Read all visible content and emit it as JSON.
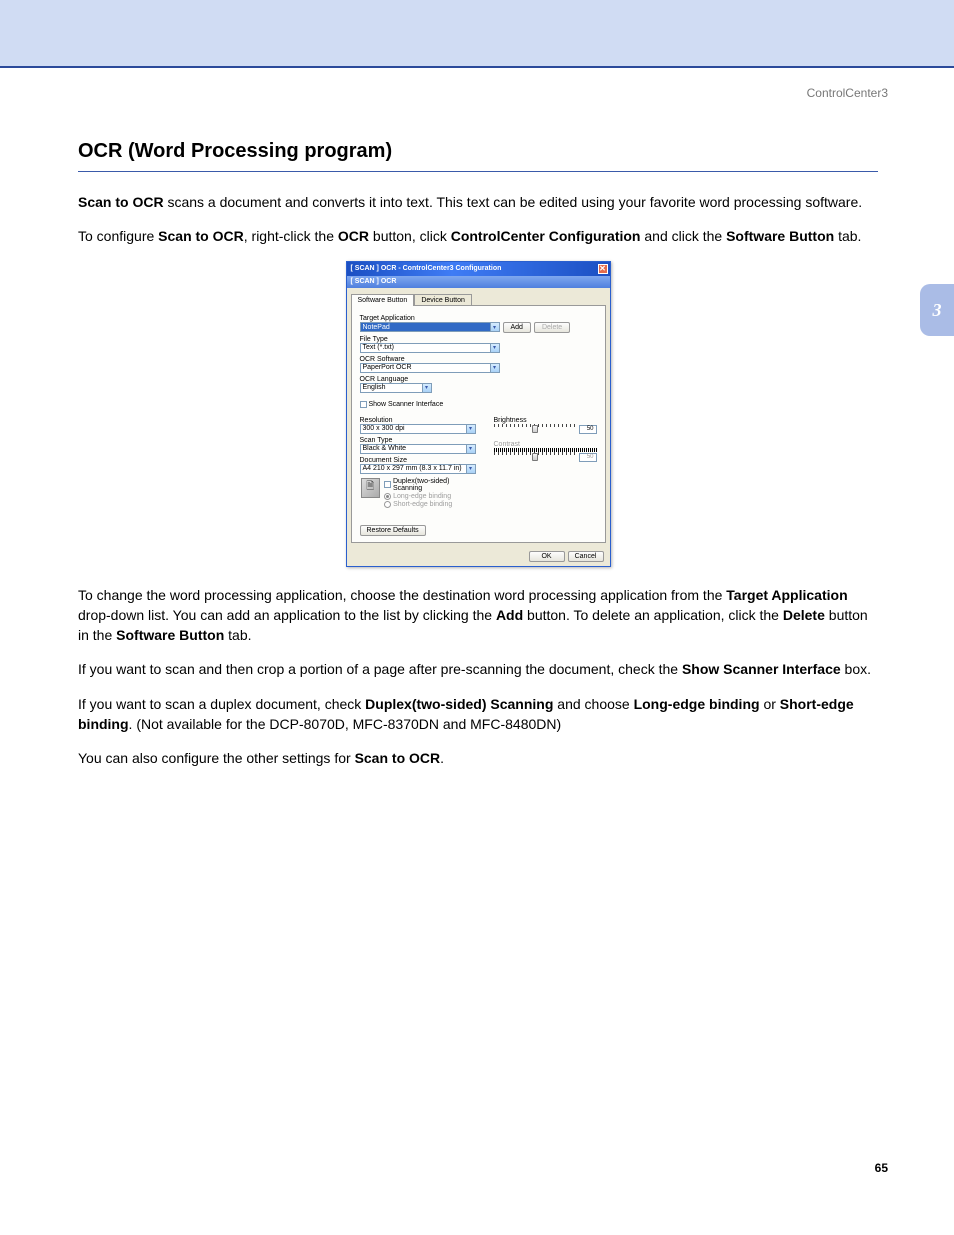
{
  "header_right": "ControlCenter3",
  "side_tab": "3",
  "page_number": "65",
  "title": "OCR (Word Processing program)",
  "para1_a": "Scan to OCR",
  "para1_b": " scans a document and converts it into text. This text can be edited using your favorite word processing software.",
  "para2_a": "To configure ",
  "para2_b": "Scan to OCR",
  "para2_c": ", right-click the ",
  "para2_d": "OCR",
  "para2_e": " button, click ",
  "para2_f": "ControlCenter Configuration",
  "para2_g": " and click the ",
  "para2_h": "Software Button",
  "para2_i": " tab.",
  "para3_a": "To change the word processing application, choose the destination word processing application from the ",
  "para3_b": "Target Application",
  "para3_c": " drop-down list. You can add an application to the list by clicking the ",
  "para3_d": "Add",
  "para3_e": " button. To delete an application, click the ",
  "para3_f": "Delete",
  "para3_g": " button in the ",
  "para3_h": "Software Button",
  "para3_i": " tab.",
  "para4_a": "If you want to scan and then crop a portion of a page after pre-scanning the document, check the ",
  "para4_b": "Show Scanner Interface",
  "para4_c": " box.",
  "para5_a": "If you want to scan a duplex document, check ",
  "para5_b": "Duplex(two-sided) Scanning",
  "para5_c": " and choose ",
  "para5_d": "Long-edge binding",
  "para5_e": " or ",
  "para5_f": "Short-edge binding",
  "para5_g": ". (Not available for the DCP-8070D, MFC-8370DN and MFC-8480DN)",
  "para6_a": "You can also configure the other settings for ",
  "para6_b": "Scan to OCR",
  "para6_c": ".",
  "dialog": {
    "title": "[  SCAN  ]   OCR - ControlCenter3 Configuration",
    "breadcrumb": "[  SCAN  ]   OCR",
    "tab_software": "Software Button",
    "tab_device": "Device Button",
    "target_app_label": "Target Application",
    "target_app_value": "NotePad",
    "add_btn": "Add",
    "delete_btn": "Delete",
    "file_type_label": "File Type",
    "file_type_value": "Text (*.txt)",
    "ocr_software_label": "OCR Software",
    "ocr_software_value": "PaperPort OCR",
    "ocr_language_label": "OCR Language",
    "ocr_language_value": "English",
    "show_scanner": "Show Scanner Interface",
    "resolution_label": "Resolution",
    "resolution_value": "300 x 300 dpi",
    "scan_type_label": "Scan Type",
    "scan_type_value": "Black & White",
    "doc_size_label": "Document Size",
    "doc_size_value": "A4 210 x 297 mm (8.3 x 11.7 in)",
    "brightness_label": "Brightness",
    "brightness_value": "50",
    "contrast_label": "Contrast",
    "contrast_value": "50",
    "duplex_label": "Duplex(two-sided) Scanning",
    "longedge_label": "Long-edge binding",
    "shortedge_label": "Short-edge binding",
    "restore_btn": "Restore Defaults",
    "ok_btn": "OK",
    "cancel_btn": "Cancel"
  }
}
